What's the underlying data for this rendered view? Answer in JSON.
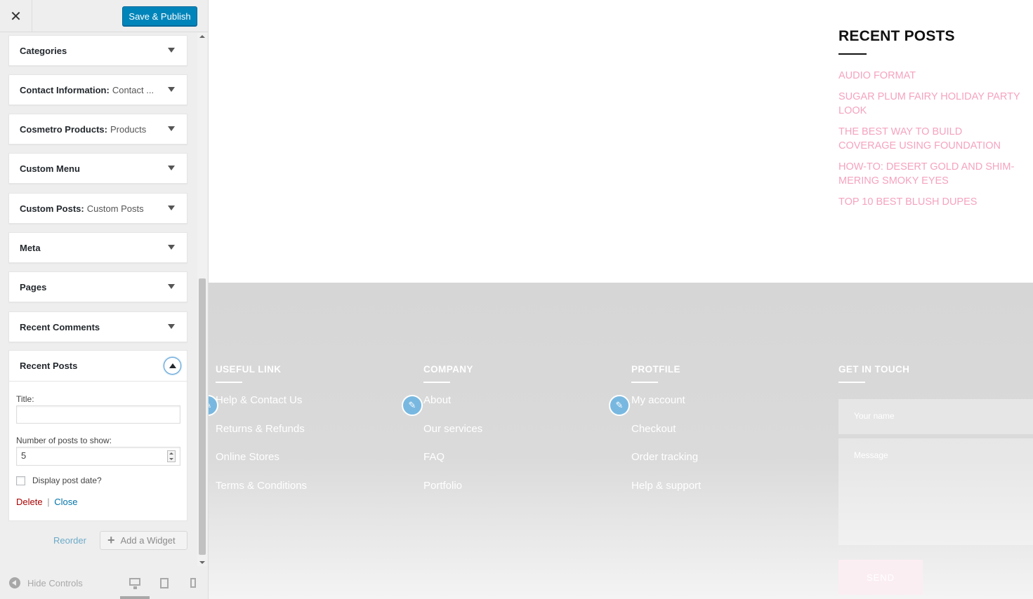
{
  "topbar": {
    "close_symbol": "✕",
    "save_label": "Save & Publish"
  },
  "widgets": [
    {
      "title": "Categories",
      "subtitle": ""
    },
    {
      "title": "Contact Information:",
      "subtitle": "Contact ..."
    },
    {
      "title": "Cosmetro Products:",
      "subtitle": "Products"
    },
    {
      "title": "Custom Menu",
      "subtitle": ""
    },
    {
      "title": "Custom Posts:",
      "subtitle": "Custom Posts"
    },
    {
      "title": "Meta",
      "subtitle": ""
    },
    {
      "title": "Pages",
      "subtitle": ""
    },
    {
      "title": "Recent Comments",
      "subtitle": ""
    }
  ],
  "expanded_widget": {
    "title": "Recent Posts",
    "title_label": "Title:",
    "title_value": "",
    "number_label": "Number of posts to show:",
    "number_value": "5",
    "display_date_label": "Display post date?",
    "delete_label": "Delete",
    "separator": "|",
    "close_label": "Close"
  },
  "sidebar_actions": {
    "reorder_label": "Reorder",
    "add_plus": "+",
    "add_widget_label": "Add a Widget"
  },
  "footer_controls": {
    "hide_controls_label": "Hide Controls"
  },
  "preview": {
    "recent_posts_title": "RECENT POSTS",
    "recent_posts": [
      "AUDIO FORMAT",
      "SUGAR PLUM FAIRY HOLIDAY PARTY LOOK",
      "THE BEST WAY TO BUILD COVERAGE USING FOUNDATION",
      "HOW-TO: DESERT GOLD AND SHIM-MERING SMOKY EYES",
      "TOP 10 BEST BLUSH DUPES"
    ],
    "footer_columns": [
      {
        "heading": "USEFUL LINK",
        "links": [
          "Help & Contact Us",
          "Returns & Refunds",
          "Online Stores",
          "Terms & Conditions"
        ]
      },
      {
        "heading": "COMPANY",
        "links": [
          "About",
          "Our services",
          "FAQ",
          "Portfolio"
        ]
      },
      {
        "heading": "PROTFILE",
        "links": [
          "My account",
          "Checkout",
          "Order tracking",
          "Help & support"
        ]
      }
    ],
    "contact": {
      "heading": "GET IN TOUCH",
      "name_placeholder": "Your name",
      "message_placeholder": "Message",
      "send_label": "SEND"
    }
  },
  "colors": {
    "accent": "#0085ba",
    "post_link": "#f5a3c0",
    "footer_bg": "#d6d6d6",
    "delete": "#aa0000"
  }
}
